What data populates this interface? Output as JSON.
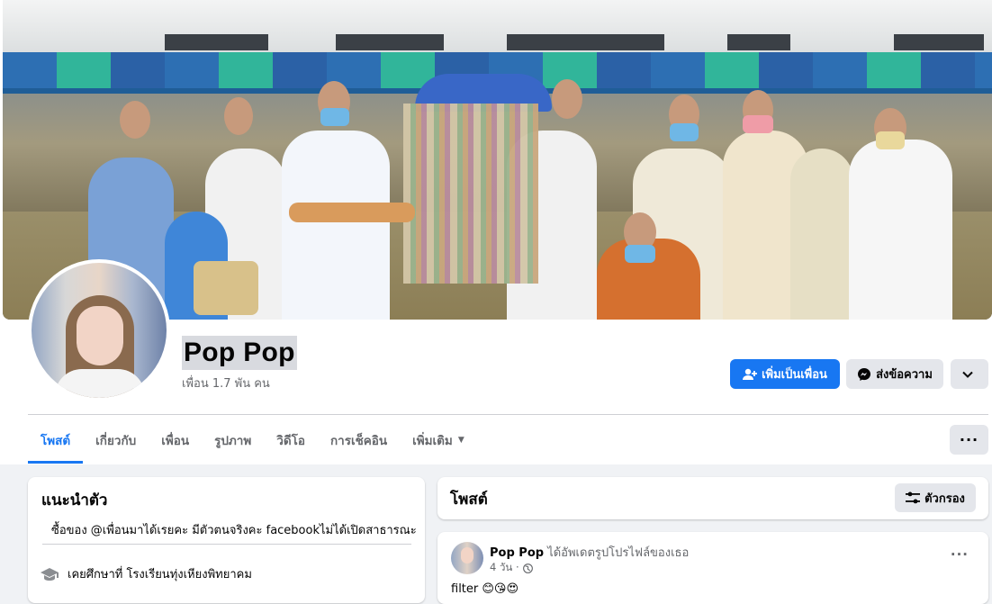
{
  "profile": {
    "name": "Pop Pop",
    "friends_count": "เพื่อน 1.7 พัน คน"
  },
  "actions": {
    "add_friend_label": "เพิ่มเป็นเพื่อน",
    "message_label": "ส่งข้อความ"
  },
  "tabs": [
    {
      "label": "โพสต์",
      "active": true
    },
    {
      "label": "เกี่ยวกับ"
    },
    {
      "label": "เพื่อน"
    },
    {
      "label": "รูปภาพ"
    },
    {
      "label": "วิดีโอ"
    },
    {
      "label": "การเช็คอิน"
    },
    {
      "label": "เพิ่มเติม"
    }
  ],
  "intro": {
    "title": "แนะนำตัว",
    "bio": "ซื้อของ @เพื่อนมาได้เรยคะ มีตัวตนจริงคะ facebookไม่ได้เปิดสาธารณะ",
    "education": "เคยศึกษาที่ โรงเรียนทุ่งเหียงพิทยาคม"
  },
  "posts_section": {
    "title": "โพสต์",
    "filter_label": "ตัวกรอง"
  },
  "post": {
    "author": "Pop Pop",
    "action": "ได้อัพเดตรูปโปรไฟล์ของเธอ",
    "time": "4 วัน ·",
    "caption": "filter 😊😘😍"
  },
  "colors": {
    "accent": "#1877f2",
    "background": "#f0f2f5",
    "button_gray": "#e4e6eb",
    "secondary_text": "#65676b"
  }
}
